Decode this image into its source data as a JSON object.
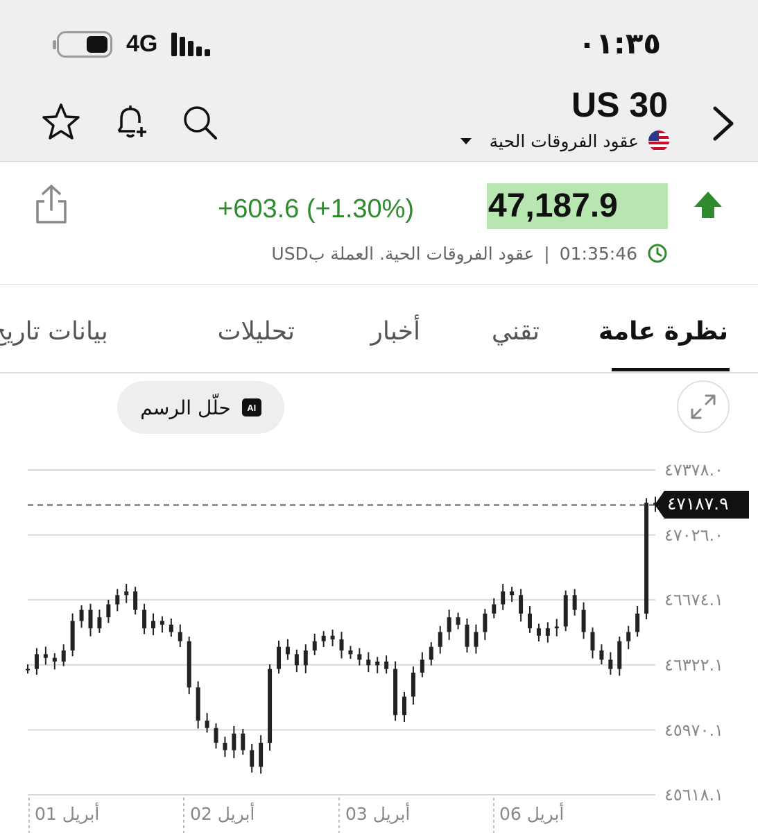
{
  "status": {
    "time": "٠١:٣٥",
    "network": "4G"
  },
  "header": {
    "symbol": "US 30",
    "instrument_type": "عقود الفروقات الحية",
    "icons": [
      "star-icon",
      "bell-plus-icon",
      "search-icon",
      "chevron-right-icon"
    ]
  },
  "quote": {
    "price": "47,187.9",
    "change": "+603.6 (+1.30%)",
    "time": "01:35:46",
    "separator": "|",
    "description": "عقود الفروقات الحية. العملة بUSD",
    "direction": "up",
    "up_color": "#2e8b2e",
    "highlight_color": "#b7e6b0"
  },
  "tabs": [
    {
      "label": "نظرة عامة",
      "active": true
    },
    {
      "label": "تقني",
      "active": false
    },
    {
      "label": "أخبار",
      "active": false
    },
    {
      "label": "تحليلات",
      "active": false
    },
    {
      "label": "بيانات تاريخ",
      "active": false
    }
  ],
  "chart_toolbar": {
    "ai_badge": "AI",
    "ai_label": "حلّل الرسم"
  },
  "chart_data": {
    "type": "candlestick",
    "y_ticks": [
      "٤٧٣٧٨.٠",
      "٤٧٠٢٦.٠",
      "٤٦٦٧٤.١",
      "٤٦٣٢٢.١",
      "٤٥٩٧٠.١",
      "٤٥٦١٨.١"
    ],
    "y_tick_values": [
      47378.0,
      47026.0,
      46674.1,
      46322.1,
      45970.1,
      45618.1
    ],
    "x_ticks": [
      "01 أبريل",
      "02 أبريل",
      "03 أبريل",
      "06 أبريل"
    ],
    "current_price_label": "٤٧١٨٧.٩",
    "current_price": 47187.9,
    "ylim": [
      45618.1,
      47378.0
    ],
    "grid": true,
    "candle_color": "#222222",
    "series_closes": [
      46300,
      46380,
      46360,
      46340,
      46400,
      46560,
      46620,
      46520,
      46580,
      46650,
      46700,
      46720,
      46620,
      46520,
      46560,
      46540,
      46500,
      46450,
      46200,
      46020,
      45980,
      45900,
      45860,
      45950,
      45860,
      45770,
      45900,
      46300,
      46420,
      46380,
      46320,
      46400,
      46450,
      46480,
      46460,
      46400,
      46380,
      46350,
      46320,
      46340,
      46300,
      46050,
      46150,
      46280,
      46350,
      46420,
      46500,
      46580,
      46540,
      46420,
      46500,
      46600,
      46650,
      46720,
      46700,
      46600,
      46520,
      46480,
      46520,
      46530,
      46700,
      46620,
      46500,
      46400,
      46350,
      46300,
      46450,
      46500,
      46600,
      47200,
      47187.9
    ]
  }
}
